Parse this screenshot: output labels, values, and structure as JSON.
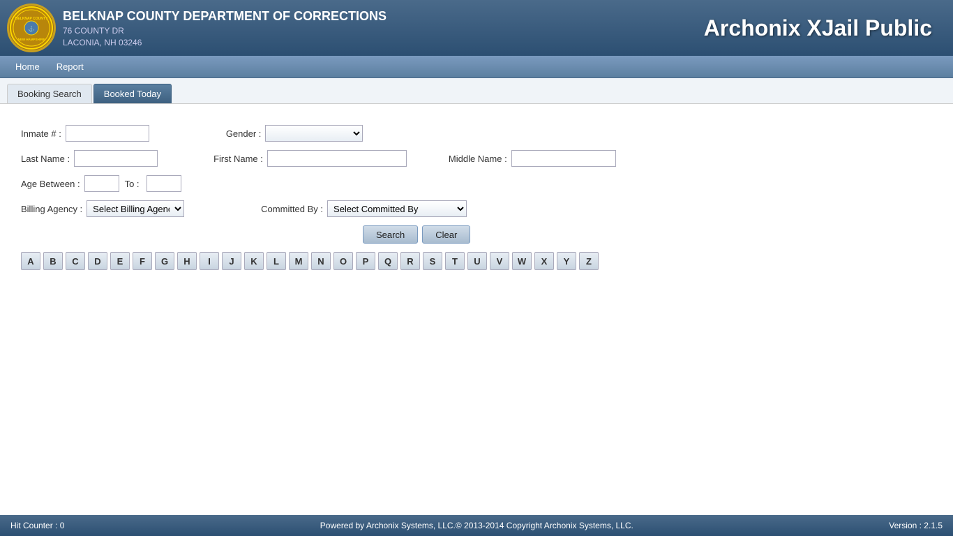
{
  "header": {
    "dept_name": "BELKNAP COUNTY DEPARTMENT OF CORRECTIONS",
    "address_line1": "76 COUNTY DR",
    "address_line2": "LACONIA, NH 03246",
    "brand": "Archonix XJail Public"
  },
  "navbar": {
    "items": [
      {
        "label": "Home",
        "id": "home"
      },
      {
        "label": "Report",
        "id": "report"
      }
    ]
  },
  "tabs": [
    {
      "label": "Booking Search",
      "active": false
    },
    {
      "label": "Booked Today",
      "active": true
    }
  ],
  "form": {
    "inmate_label": "Inmate # :",
    "inmate_value": "",
    "gender_label": "Gender :",
    "gender_placeholder": "",
    "lastname_label": "Last Name :",
    "lastname_value": "",
    "firstname_label": "First Name :",
    "firstname_value": "",
    "middlename_label": "Middle Name :",
    "middlename_value": "",
    "age_label": "Age Between :",
    "age_from": "",
    "age_to_label": "To :",
    "age_to": "",
    "billing_label": "Billing Agency :",
    "billing_placeholder": "Select Billing Agency",
    "committed_label": "Committed By :",
    "committed_placeholder": "Select Committed By",
    "search_btn": "Search",
    "clear_btn": "Clear"
  },
  "alphabet": [
    "A",
    "B",
    "C",
    "D",
    "E",
    "F",
    "G",
    "H",
    "I",
    "J",
    "K",
    "L",
    "M",
    "N",
    "O",
    "P",
    "Q",
    "R",
    "S",
    "T",
    "U",
    "V",
    "W",
    "X",
    "Y",
    "Z"
  ],
  "footer": {
    "hit_counter": "Hit Counter : 0",
    "powered_by": "Powered by Archonix Systems, LLC.© 2013-2014 Copyright Archonix Systems, LLC.",
    "version": "Version : 2.1.5"
  }
}
